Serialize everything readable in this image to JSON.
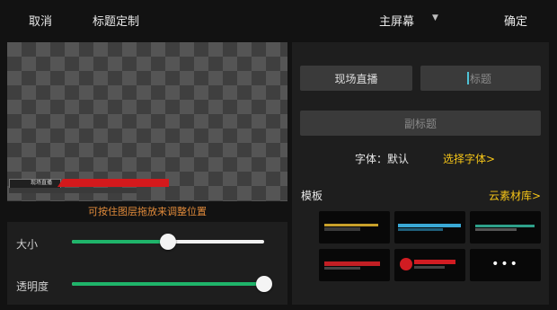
{
  "topbar": {
    "cancel": "取消",
    "title": "标题定制",
    "screen": "主屏幕",
    "confirm": "确定"
  },
  "preview": {
    "hint": "可按住图层拖放来调整位置",
    "lower_third_text": "现场直播"
  },
  "sliders": [
    {
      "label": "大小",
      "value": 0.5
    },
    {
      "label": "透明度",
      "value": 1.0
    }
  ],
  "panel": {
    "live_button": "现场直播",
    "title_placeholder": "标题",
    "subtitle_placeholder": "副标题",
    "font_label": "字体：默认",
    "choose_font": "选择字体>",
    "template_label": "模板",
    "cloud_library": "云素材库>"
  },
  "templates": [
    {
      "name": "template-gold-bar",
      "accent": "#c8a02a"
    },
    {
      "name": "template-cyan-bar",
      "accent": "#3aa9d6"
    },
    {
      "name": "template-teal-bar",
      "accent": "#2ea08a"
    },
    {
      "name": "template-red-bar",
      "accent": "#c21f24"
    },
    {
      "name": "template-red-circle",
      "accent": "#d11c22"
    },
    {
      "name": "template-more",
      "accent": "#ffffff"
    }
  ],
  "colors": {
    "accent_green": "#1fb46a",
    "accent_yellow": "#f5c518",
    "hint_orange": "#e08a3a"
  }
}
